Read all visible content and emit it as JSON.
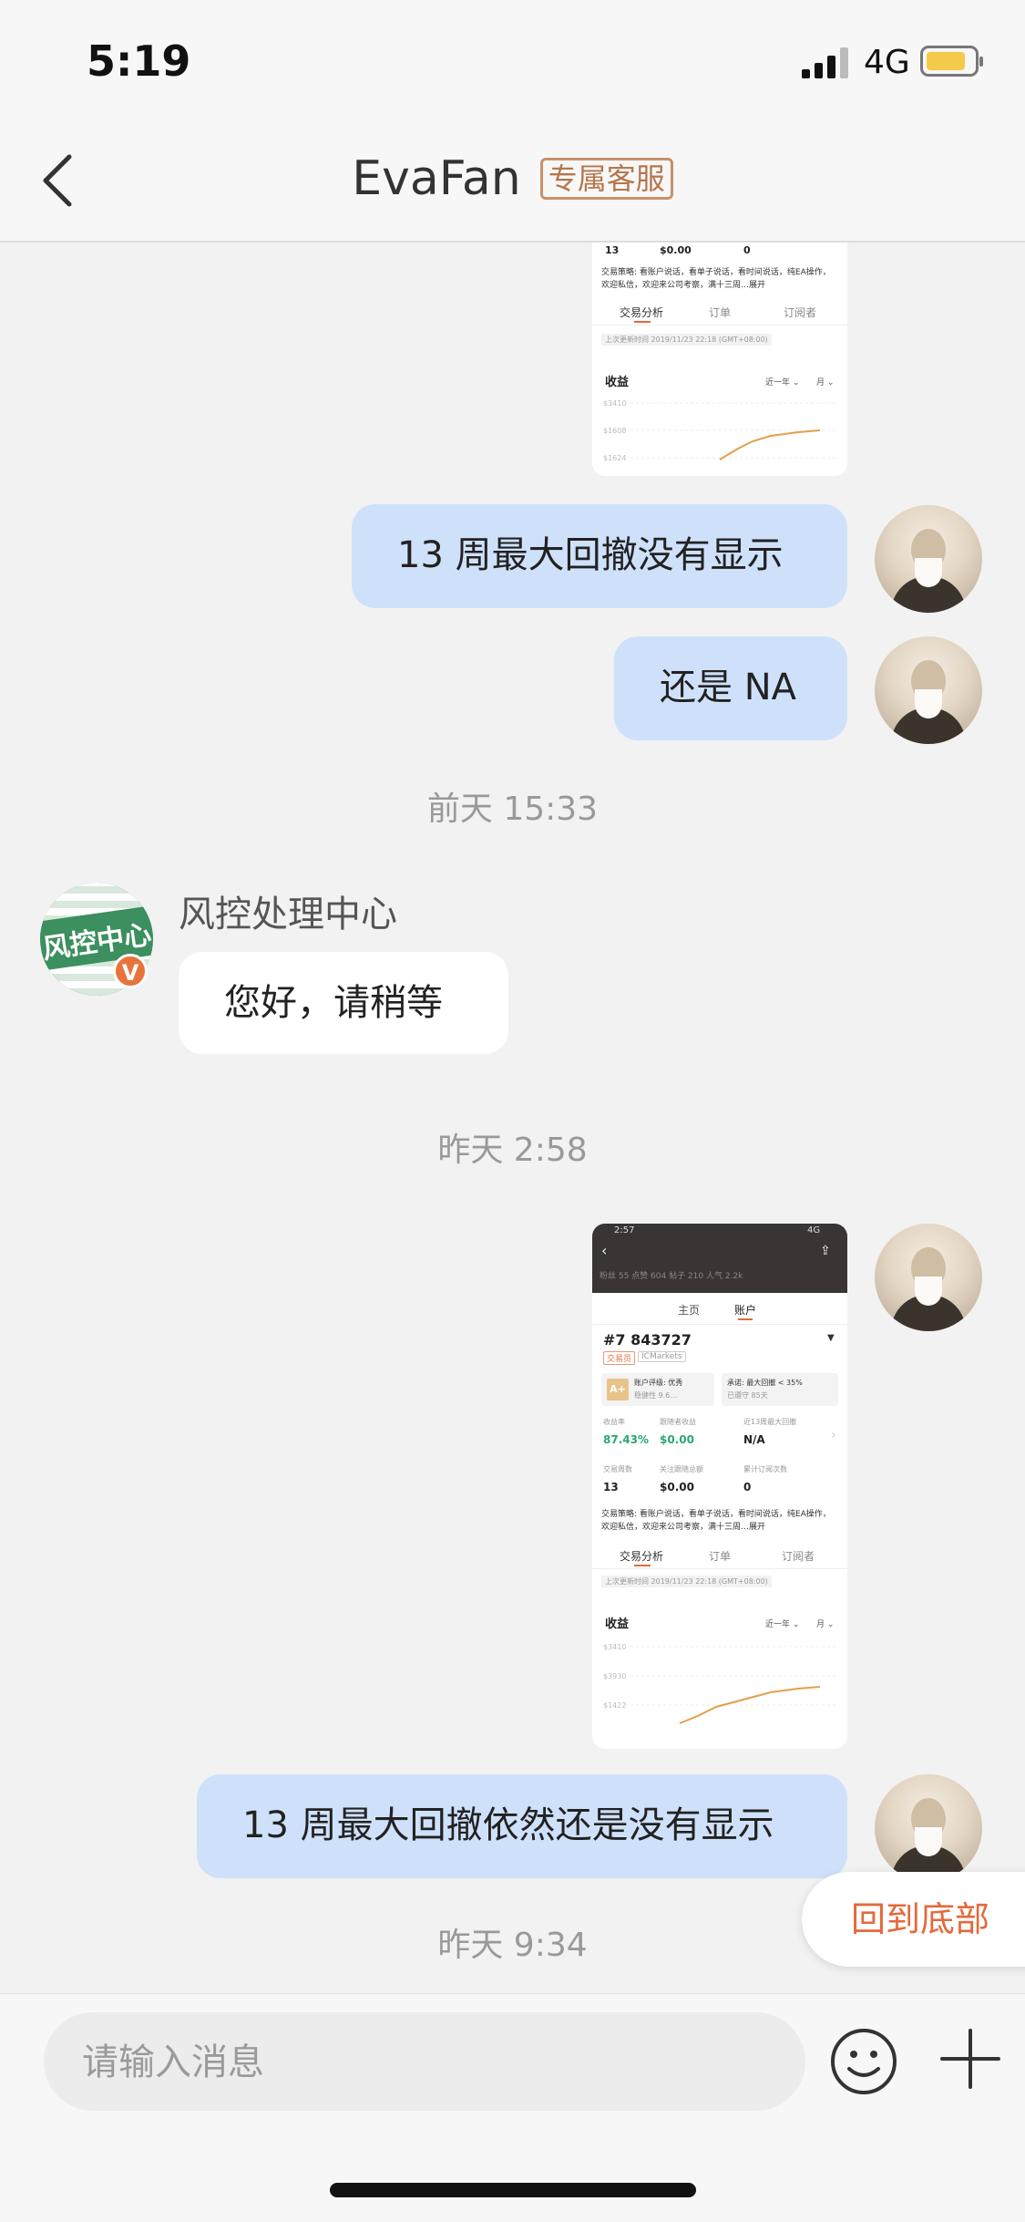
{
  "status_bar": {
    "time": "5:19",
    "network": "4G"
  },
  "header": {
    "title": "EvaFan",
    "badge": "专属客服"
  },
  "shot_top": {
    "row_values": [
      "13",
      "$0.00",
      "0"
    ],
    "strategy": "交易策略: 看账户说话，看单子说话，看时间说话，纯EA操作，欢迎私信，欢迎来公司考察，满十三周…展开",
    "tabs": [
      "交易分析",
      "订单",
      "订阅者"
    ],
    "updated": "上次更新时间 2019/11/23 22:18 (GMT+08:00)",
    "section": "收益",
    "range": "近一年 ⌄",
    "period": "月 ⌄",
    "y_labels": [
      "$3410",
      "$1608",
      "$1624"
    ]
  },
  "messages": {
    "m1": "13 周最大回撤没有显示",
    "m2": "还是 NA",
    "ts1": "前天 15:33",
    "sender": "风控处理中心",
    "sender_avatar_text": "风控中心",
    "verify": "V",
    "m3": "您好，请稍等",
    "ts2": "昨天 2:58",
    "m4": "13 周最大回撤依然还是没有显示",
    "ts3": "昨天 9:34"
  },
  "shot_main": {
    "status_time": "2:57",
    "status_right": "4G",
    "header_stats": "粉丝 55   点赞 604   帖子 210   人气 2.2k",
    "nav_tabs": [
      "主页",
      "账户"
    ],
    "account": "#7 843727",
    "tags": [
      "交易员",
      "ICMarkets"
    ],
    "rating": "账户评级: 优秀",
    "rating_sub": "稳健性 9.6…",
    "grade": "A+",
    "promise": "承诺: 最大回撤 < 35%",
    "promise_sub": "已遵守 85天",
    "labels_row1": [
      "收益率",
      "跟随者收益",
      "近13周最大回撤"
    ],
    "values_row1": [
      "87.43%",
      "$0.00",
      "N/A"
    ],
    "labels_row2": [
      "交易周数",
      "关注跟随总额",
      "累计订阅次数"
    ],
    "values_row2": [
      "13",
      "$0.00",
      "0"
    ],
    "strategy": "交易策略: 看账户说话，看单子说话，看时间说话，纯EA操作，欢迎私信，欢迎来公司考察，满十三周…展开",
    "sub_tabs": [
      "交易分析",
      "订单",
      "订阅者"
    ],
    "updated": "上次更新时间 2019/11/23 22:18 (GMT+08:00)",
    "section": "收益",
    "range": "近一年 ⌄",
    "period": "月 ⌄",
    "y_labels": [
      "$3410",
      "$3930",
      "$1422"
    ]
  },
  "floating": {
    "to_bottom": "回到底部"
  },
  "input": {
    "placeholder": "请输入消息"
  }
}
